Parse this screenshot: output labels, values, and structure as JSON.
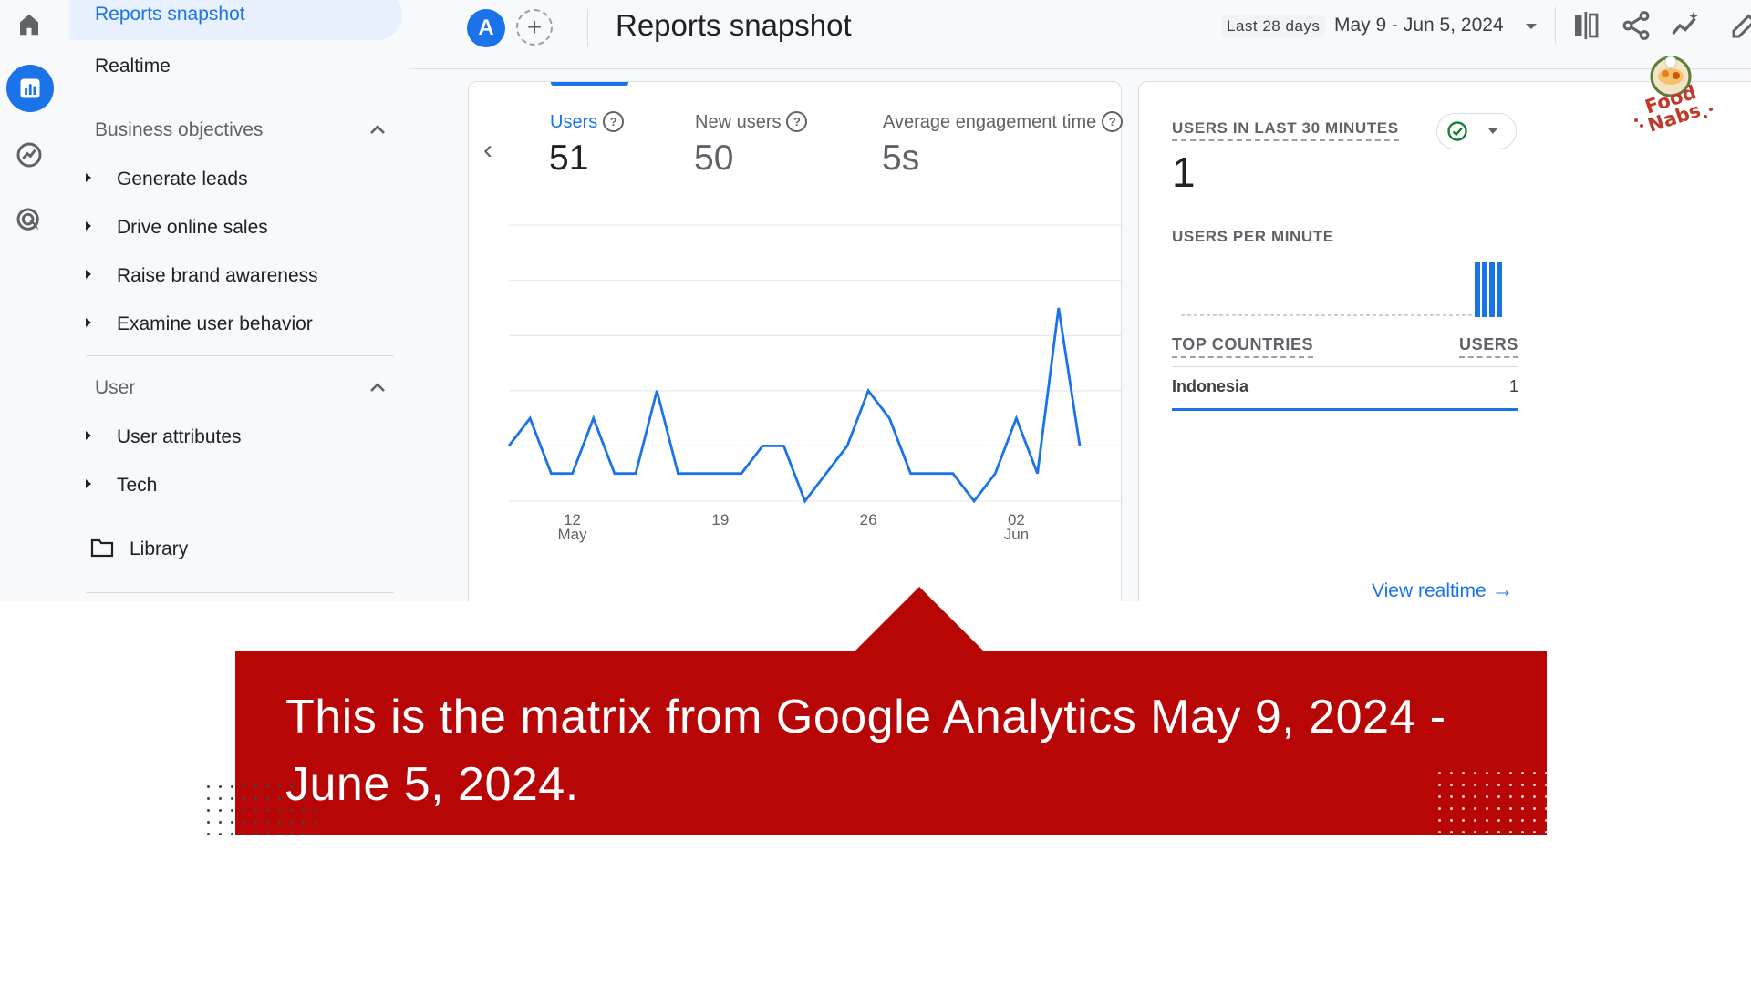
{
  "nav": {
    "active_item": "Reports snapshot",
    "realtime": "Realtime",
    "business_objectives": {
      "heading": "Business objectives",
      "items": [
        "Generate leads",
        "Drive online sales",
        "Raise brand awareness",
        "Examine user behavior"
      ]
    },
    "user": {
      "heading": "User",
      "items": [
        "User attributes",
        "Tech"
      ]
    },
    "library": "Library"
  },
  "header": {
    "avatar_letter": "A",
    "title": "Reports snapshot",
    "date_label": "Last 28 days",
    "date_range": "May 9 - Jun 5, 2024"
  },
  "metrics": [
    {
      "label": "Users",
      "value": "51",
      "selected": true
    },
    {
      "label": "New users",
      "value": "50",
      "selected": false
    },
    {
      "label": "Average engagement time",
      "value": "5s",
      "selected": false
    }
  ],
  "chart_data": {
    "type": "line",
    "series": [
      {
        "values": [
          2,
          3,
          1,
          1,
          3,
          1,
          1,
          4,
          1,
          1,
          1,
          1,
          2,
          2,
          0,
          1,
          2,
          4,
          3,
          1,
          1,
          1,
          0,
          1,
          3,
          1,
          7,
          2
        ]
      }
    ],
    "x_ticks": [
      {
        "index": 3,
        "label": "12",
        "sub": "May"
      },
      {
        "index": 10,
        "label": "19",
        "sub": ""
      },
      {
        "index": 17,
        "label": "26",
        "sub": ""
      },
      {
        "index": 24,
        "label": "02",
        "sub": "Jun"
      }
    ],
    "y_ticks": [
      "0",
      "2",
      "4",
      "6",
      "8",
      "10"
    ],
    "ylim": [
      0,
      10
    ],
    "grid": true,
    "color": "#1a73e8"
  },
  "realtime": {
    "users_label": "USERS IN LAST 30 MINUTES",
    "users_value": "1",
    "per_minute_label": "USERS PER MINUTE",
    "top_countries_label": "TOP COUNTRIES",
    "users_col_label": "USERS",
    "countries": [
      {
        "name": "Indonesia",
        "users": "1"
      }
    ],
    "view_realtime": "View realtime"
  },
  "logo_text": "Food Nabs",
  "caption": "This is the matrix from Google Analytics May 9, 2024 - June 5, 2024."
}
